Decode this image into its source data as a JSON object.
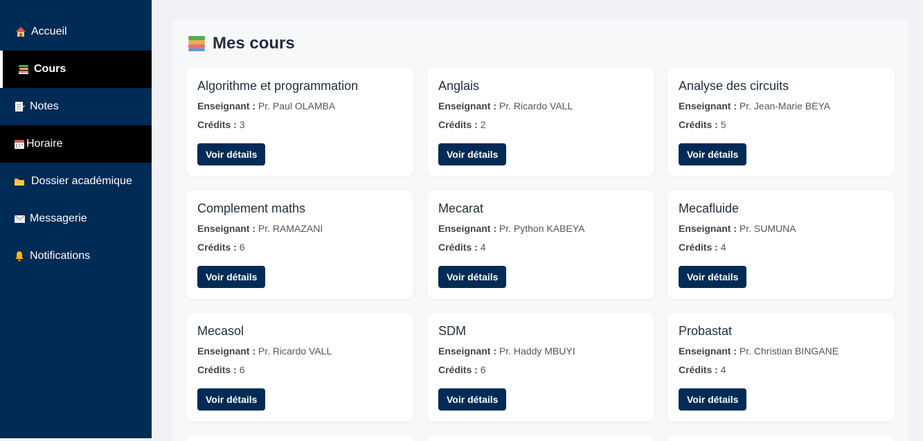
{
  "sidebar": {
    "items": [
      {
        "label": "Accueil",
        "icon": "house-icon"
      },
      {
        "label": "Cours",
        "icon": "books-icon"
      },
      {
        "label": "Notes",
        "icon": "memo-icon"
      },
      {
        "label": "Horaire",
        "icon": "calendar-icon"
      },
      {
        "label": "Dossier académique",
        "icon": "folder-icon"
      },
      {
        "label": "Messagerie",
        "icon": "envelope-icon"
      },
      {
        "label": "Notifications",
        "icon": "bell-icon"
      }
    ]
  },
  "main": {
    "title": "Mes cours",
    "title_icon": "books-icon",
    "teacher_label": "Enseignant :",
    "credits_label": "Crédits :",
    "button_label": "Voir détails",
    "courses": [
      {
        "name": "Algorithme et programmation",
        "teacher": "Pr. Paul OLAMBA",
        "credits": "3"
      },
      {
        "name": "Anglais",
        "teacher": "Pr. Ricardo VALL",
        "credits": "2"
      },
      {
        "name": "Analyse des circuits",
        "teacher": "Pr. Jean-Marie BEYA",
        "credits": "5"
      },
      {
        "name": "Complement maths",
        "teacher": "Pr. RAMAZANI",
        "credits": "6"
      },
      {
        "name": "Mecarat",
        "teacher": "Pr. Python KABEYA",
        "credits": "4"
      },
      {
        "name": "Mecafluide",
        "teacher": "Pr. SUMUNA",
        "credits": "4"
      },
      {
        "name": "Mecasol",
        "teacher": "Pr. Ricardo VALL",
        "credits": "6"
      },
      {
        "name": "SDM",
        "teacher": "Pr. Haddy MBUYI",
        "credits": "6"
      },
      {
        "name": "Probastat",
        "teacher": "Pr. Christian BINGANE",
        "credits": "4"
      }
    ]
  },
  "colors": {
    "sidebar_bg": "#002b55",
    "active_bg": "#000000",
    "button_bg": "#002b55",
    "page_bg": "#f0f2f5"
  }
}
